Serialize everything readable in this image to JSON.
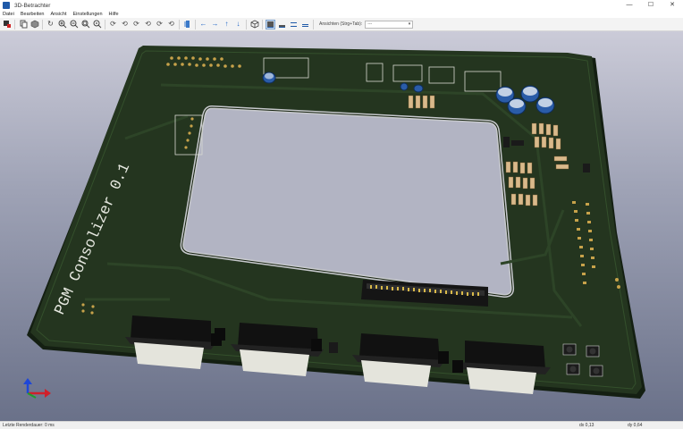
{
  "window": {
    "title": "3D-Betrachter",
    "minimize": "—",
    "maximize": "☐",
    "close": "✕"
  },
  "menu": [
    "Datei",
    "Bearbeiten",
    "Ansicht",
    "Einstellungen",
    "Hilfe"
  ],
  "toolbar": {
    "view_label": "Ansichten (Strg+Tab):",
    "view_value": "---"
  },
  "board": {
    "silkscreen_text": "PGM Consolizer 0.1"
  },
  "status": {
    "left": "Letzte Renderdauer: 0 ms",
    "dx": "dx 0,13",
    "dy": "dy 0,64"
  },
  "colors": {
    "pcb": "#24351f",
    "silk": "#e6e8e0",
    "viewport_top": "#cbcbd8",
    "viewport_bottom": "#6a7189"
  },
  "icons": [
    "render-icon",
    "copy-icon",
    "board-3d-icon",
    "reload-icon",
    "zoom-in-icon",
    "zoom-out-icon",
    "zoom-fit-icon",
    "zoom-auto-icon",
    "rotate-x-icon",
    "rotate-x-neg-icon",
    "rotate-y-icon",
    "rotate-y-neg-icon",
    "rotate-z-icon",
    "rotate-z-neg-icon",
    "flip-icon",
    "pan-left-icon",
    "pan-right-icon",
    "pan-up-icon",
    "pan-down-icon",
    "ortho-icon",
    "layers-icon"
  ]
}
